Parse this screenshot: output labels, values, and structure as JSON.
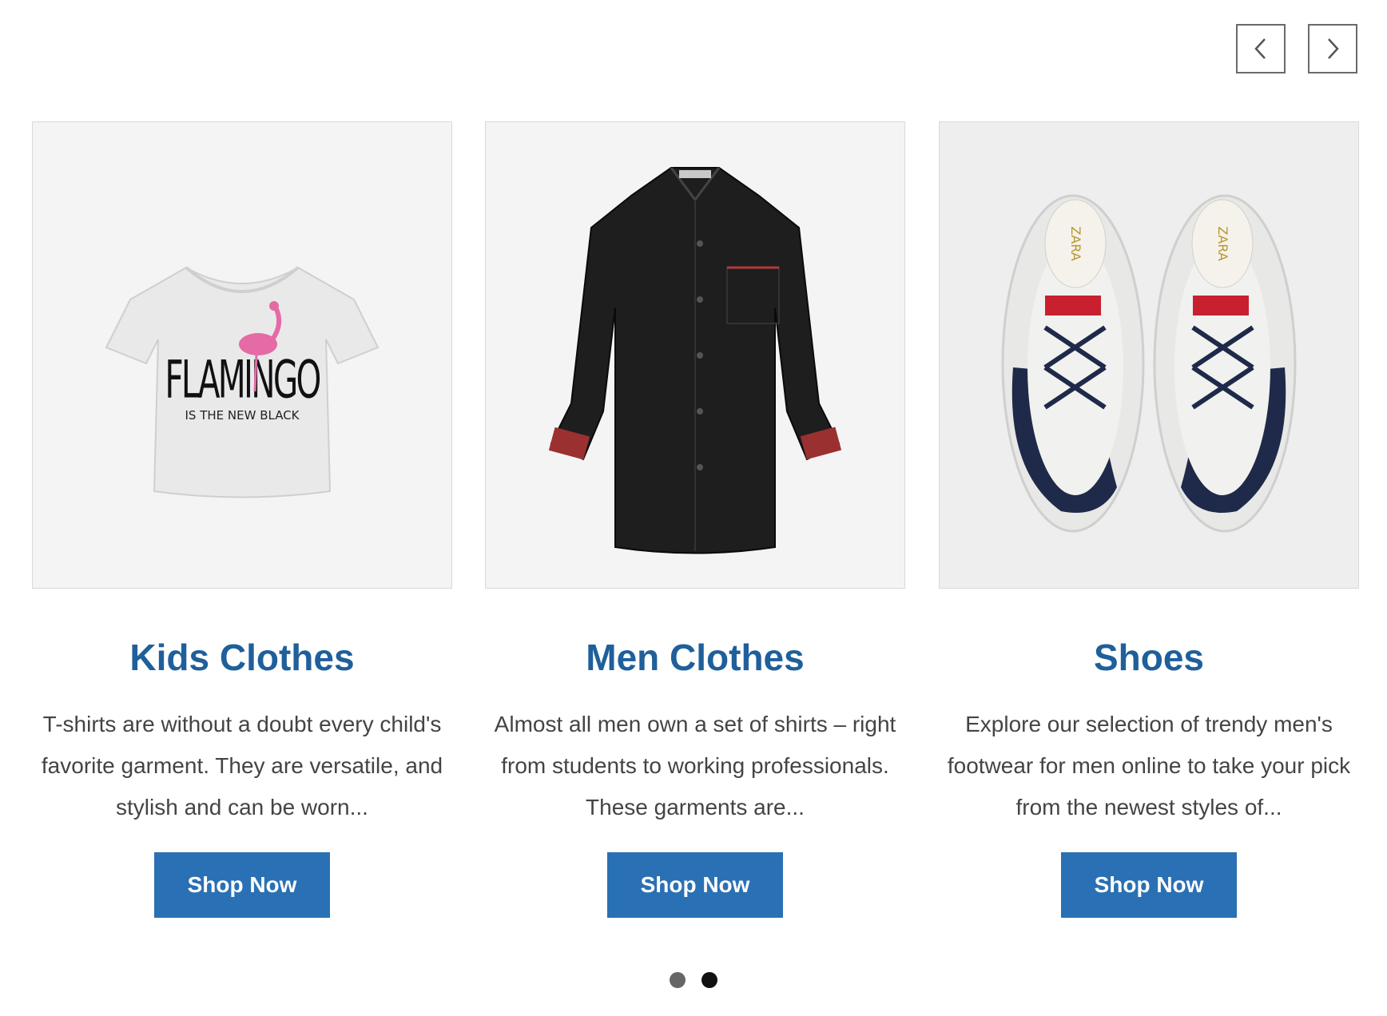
{
  "carousel": {
    "prev_icon": "chevron-left-icon",
    "next_icon": "chevron-right-icon",
    "nav_border_color": "#6a6a6a"
  },
  "cards": [
    {
      "image": "kids-tshirt-image",
      "shirt_print_title": "FLAMINGO",
      "shirt_print_subtitle": "IS THE NEW BLACK",
      "title": "Kids Clothes",
      "description": "T-shirts are without a doubt every child's favorite garment. They are versatile, and stylish and can be worn...",
      "button_label": "Shop Now"
    },
    {
      "image": "men-black-shirt-image",
      "title": "Men Clothes",
      "description": "Almost all men own a set of shirts – right from students to working professionals. These garments are...",
      "button_label": "Shop Now"
    },
    {
      "image": "sneakers-image",
      "shoe_brand_print": "ZARA",
      "title": "Shoes",
      "description": "Explore our selection of trendy men's footwear for men online to take your pick from the newest styles of...",
      "button_label": "Shop Now"
    }
  ],
  "pagination": {
    "total": 2,
    "active_index": 2
  },
  "colors": {
    "title": "#1f5f9b",
    "button": "#2a70b4",
    "text": "#444444"
  }
}
